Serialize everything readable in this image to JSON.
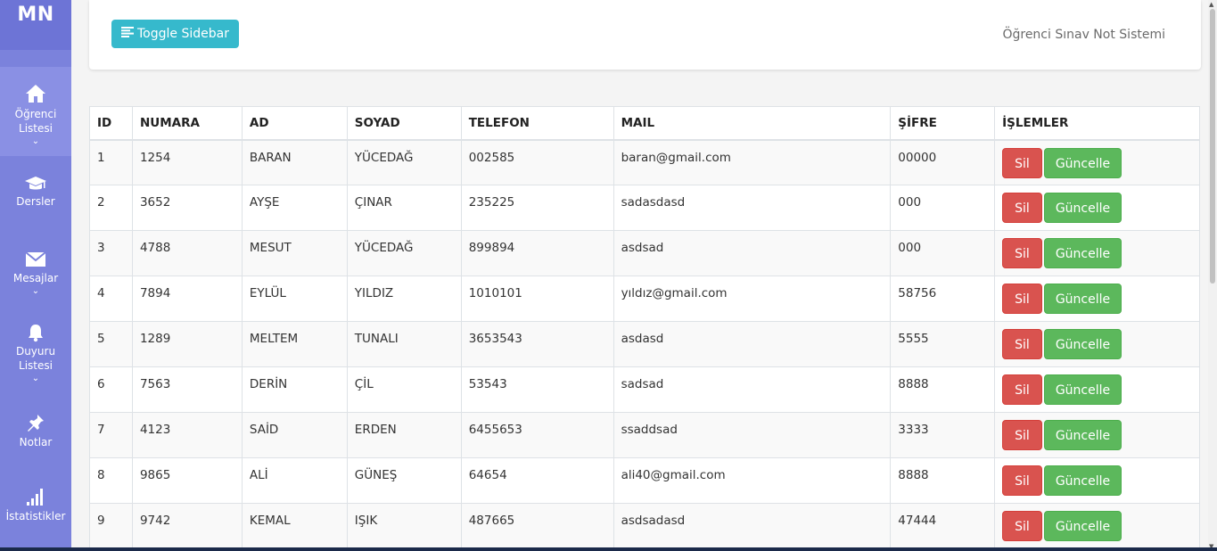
{
  "brand": "MN",
  "sidebar": {
    "items": [
      {
        "label": "Öğrenci Listesi",
        "icon": "home-icon",
        "has_chevron": true
      },
      {
        "label": "Dersler",
        "icon": "graduation-cap-icon",
        "has_chevron": false
      },
      {
        "label": "Mesajlar",
        "icon": "envelope-icon",
        "has_chevron": true
      },
      {
        "label": "Duyuru Listesi",
        "icon": "bell-icon",
        "has_chevron": true
      },
      {
        "label": "Notlar",
        "icon": "pin-icon",
        "has_chevron": false
      },
      {
        "label": "İstatistikler",
        "icon": "bar-chart-icon",
        "has_chevron": false
      }
    ],
    "chevron": "⌄"
  },
  "topbar": {
    "toggle_label": "Toggle Sidebar",
    "title": "Öğrenci Sınav Not Sistemi"
  },
  "table": {
    "headers": [
      "ID",
      "NUMARA",
      "AD",
      "SOYAD",
      "TELEFON",
      "MAIL",
      "ŞİFRE",
      "İŞLEMLER"
    ],
    "rows": [
      [
        "1",
        "1254",
        "BARAN",
        "YÜCEDAĞ",
        "002585",
        "baran@gmail.com",
        "00000"
      ],
      [
        "2",
        "3652",
        "AYŞE",
        "ÇINAR",
        "235225",
        "sadasdasd",
        "000"
      ],
      [
        "3",
        "4788",
        "MESUT",
        "YÜCEDAĞ",
        "899894",
        "asdsad",
        "000"
      ],
      [
        "4",
        "7894",
        "EYLÜL",
        "YILDIZ",
        "1010101",
        "yıldız@gmail.com",
        "58756"
      ],
      [
        "5",
        "1289",
        "MELTEM",
        "TUNALI",
        "3653543",
        "asdasd",
        "5555"
      ],
      [
        "6",
        "7563",
        "DERİN",
        "ÇİL",
        "53543",
        "sadsad",
        "8888"
      ],
      [
        "7",
        "4123",
        "SAİD",
        "ERDEN",
        "6455653",
        "ssaddsad",
        "3333"
      ],
      [
        "8",
        "9865",
        "ALİ",
        "GÜNEŞ",
        "64654",
        "ali40@gmail.com",
        "8888"
      ],
      [
        "9",
        "9742",
        "KEMAL",
        "IŞIK",
        "487665",
        "asdsadasd",
        "47444"
      ]
    ],
    "delete_label": "Sil",
    "update_label": "Güncelle"
  },
  "colors": {
    "sidebar": "#7b82dc",
    "toggle_button": "#36b9cc",
    "delete_button": "#d9534f",
    "update_button": "#5cb85c"
  }
}
